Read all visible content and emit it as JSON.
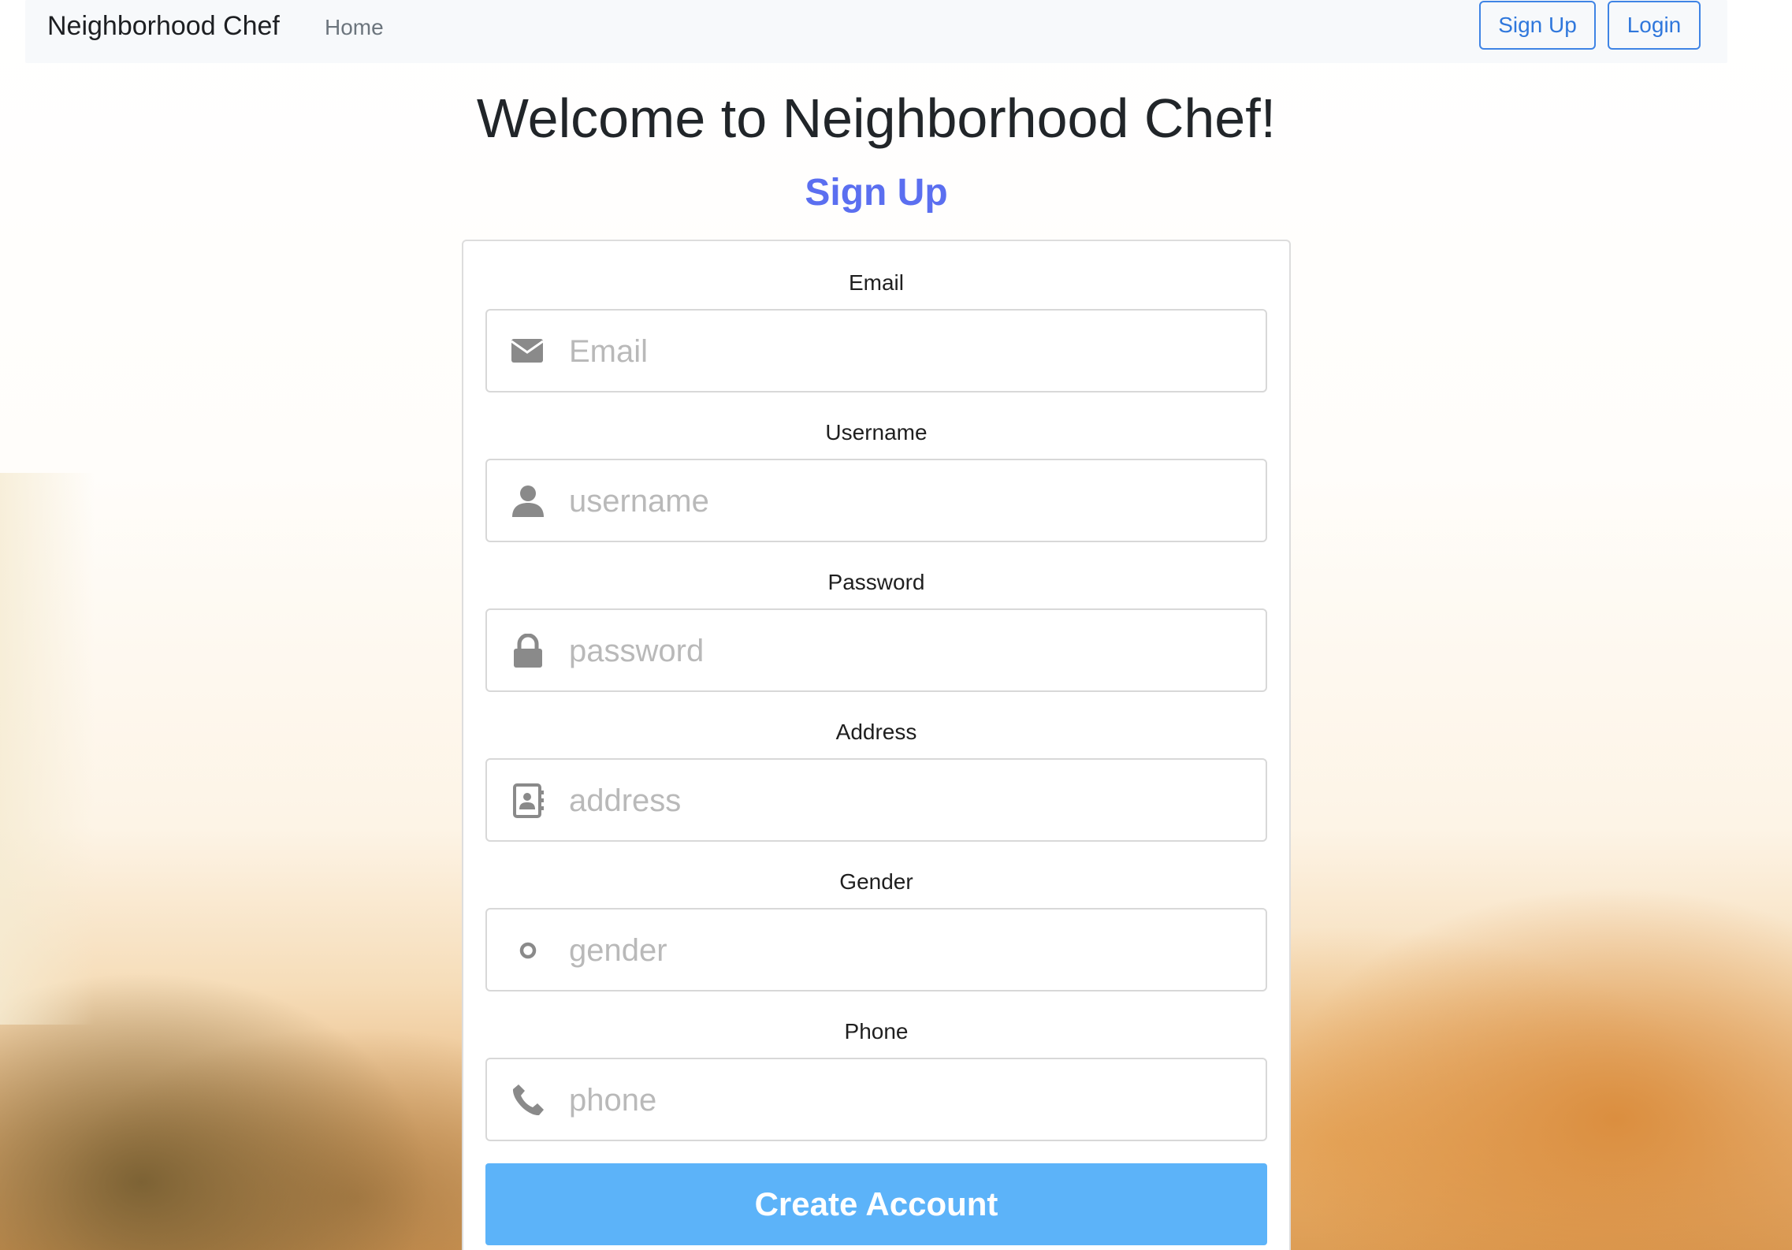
{
  "navbar": {
    "brand": "Neighborhood Chef",
    "home_link": "Home",
    "signup_button": "Sign Up",
    "login_button": "Login"
  },
  "main": {
    "welcome_heading": "Welcome to Neighborhood Chef!",
    "form_title": "Sign Up"
  },
  "form": {
    "fields": [
      {
        "label": "Email",
        "placeholder": "Email",
        "icon": "envelope-icon"
      },
      {
        "label": "Username",
        "placeholder": "username",
        "icon": "user-icon"
      },
      {
        "label": "Password",
        "placeholder": "password",
        "icon": "lock-icon"
      },
      {
        "label": "Address",
        "placeholder": "address",
        "icon": "address-book-icon"
      },
      {
        "label": "Gender",
        "placeholder": "gender",
        "icon": "circle-icon"
      },
      {
        "label": "Phone",
        "placeholder": "phone",
        "icon": "phone-icon"
      }
    ],
    "submit_label": "Create Account"
  },
  "colors": {
    "accent_title": "#5b6ff0",
    "nav_button": "#3f84e5",
    "submit_button": "#5cb3f9",
    "icon_gray": "#8a8a8a"
  }
}
